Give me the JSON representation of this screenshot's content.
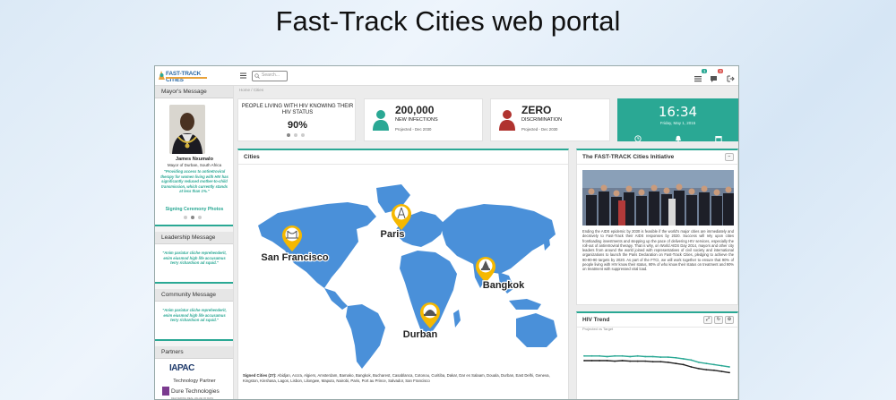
{
  "slide_title": "Fast-Track Cities web portal",
  "topbar": {
    "logo_text": "FAST-TRACK CITIES",
    "search_placeholder": "Search...",
    "notifications": [
      {
        "icon": "list-icon",
        "count": "1",
        "color": "#2aa894"
      },
      {
        "icon": "chat-icon",
        "count": "0",
        "color": "#d9534f"
      },
      {
        "icon": "logout-icon"
      }
    ]
  },
  "sidebar": {
    "mayor": {
      "heading": "Mayor's Message",
      "name": "James Nxumalo",
      "role": "Mayor of Durban, South Africa",
      "quote": "\"Providing access to antiretroviral therapy for women living with HIV has significantly reduced mother-to-child transmission, which currently stands at less than 1%.\"",
      "link": "Signing Ceremony Photos"
    },
    "leadership": {
      "heading": "Leadership Message",
      "quote": "\"Anim pariatur cliche reprehenderit, enim eiusmod high life accusamus terry richardson ad squid.\""
    },
    "community": {
      "heading": "Community Message",
      "quote": "\"Anim pariatur cliche reprehenderit, enim eiusmod high life accusamus terry richardson ad squid.\""
    },
    "partners": {
      "heading": "Partners",
      "partner1": "IAPAC",
      "partner1_label": "Technology Partner",
      "partner2": "Dure Technologies",
      "partner2_sub": "DELIVERING REAL VALUE OF DATA"
    }
  },
  "breadcrumb": {
    "home": "Home",
    "sep": "/",
    "current": "Cities"
  },
  "kpis": {
    "k1": {
      "title": "PEOPLE LIVING WITH HIV KNOWING THEIR HIV STATUS",
      "value": "90%"
    },
    "k2": {
      "value": "200,000",
      "label": "NEW INFECTIONS",
      "sub": "Projected - Dec 2030",
      "color": "#2aa894"
    },
    "k3": {
      "value": "ZERO",
      "label": "DISCRIMINATION",
      "sub": "Projected - Dec 2030",
      "color": "#b0332f"
    },
    "k4": {
      "time": "16:34",
      "date": "Friday, May 1, 2015"
    }
  },
  "cities_panel": {
    "title": "Cities",
    "markers": [
      {
        "name": "San Francisco",
        "icon": "bridge-icon"
      },
      {
        "name": "Paris",
        "icon": "eiffel-tower-icon"
      },
      {
        "name": "Bangkok",
        "icon": "temple-icon"
      },
      {
        "name": "Durban",
        "icon": "stadium-icon"
      }
    ],
    "signed_label": "Signed Cities (27):",
    "signed_list": "Abidjan, Accra, Algiers, Amsterdam, Bamako, Bangkok, Bucharest, Casablanca, Cotonou, Curitiba, Dakar, Dar es Salaam, Douala, Durban, East Delhi, Geneva, Kingston, Kinshasa, Lagos, Lisbon, Lilongwe, Maputo, Nairobi, Paris, Port au Prince, Salvador, San Francisco"
  },
  "initiative_panel": {
    "title": "The FAST-TRACK Cities Initiative",
    "text": "Ending the AIDS epidemic by 2030 is feasible if the world's major cities are immediately and decisively to Fast-Track their AIDS responses by 2020. Success will rely upon cities frontloading investments and stepping up the pace of delivering HIV services, especially the roll-out of antiretroviral therapy. That is why, on World AIDS Day 2014, mayors and other city leaders from around the world joined with representatives of civil society and international organizations to launch the Paris Declaration on Fast-Track Cities, pledging to achieve the 90-90-90 targets by 2020. As part of the FTCI, we will work together to ensure that 90% of people living with HIV know their status, 90% of who know their status on treatment and 90% on treatment with suppressed viral load."
  },
  "trend_panel": {
    "title": "HIV Trend",
    "subtitle": "Projected vs Target"
  },
  "chart_data": {
    "type": "line",
    "title": "HIV Trend",
    "subtitle": "Projected vs Target",
    "x": [
      1,
      2,
      3,
      4,
      5,
      6,
      7,
      8,
      9,
      10,
      11,
      12,
      13,
      14,
      15,
      16,
      17,
      18,
      19,
      20
    ],
    "series": [
      {
        "color": "#2aa894",
        "values": [
          69,
          69,
          69,
          68,
          69,
          69,
          68,
          69,
          68,
          68,
          67,
          67,
          66,
          64,
          62,
          58,
          56,
          54,
          52,
          50
        ]
      },
      {
        "color": "#222222",
        "values": [
          61,
          61,
          61,
          61,
          60,
          61,
          60,
          60,
          60,
          59,
          59,
          58,
          56,
          54,
          50,
          47,
          45,
          44,
          42,
          40
        ]
      }
    ],
    "ylim": [
      0,
      100
    ],
    "grid": false,
    "legend": "none"
  }
}
